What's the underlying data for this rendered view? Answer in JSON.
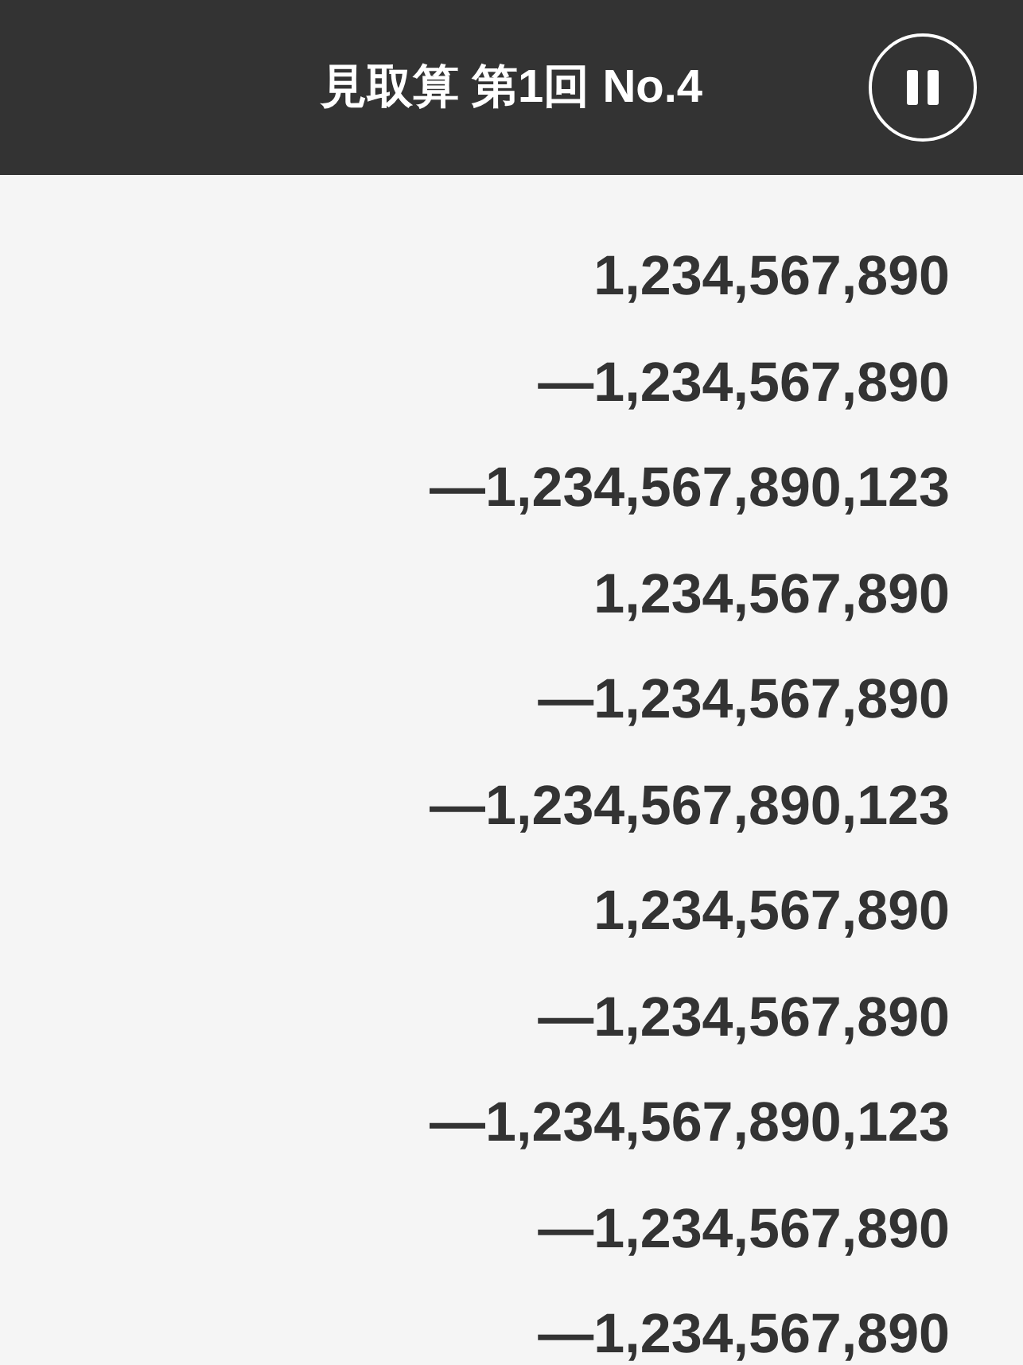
{
  "header": {
    "title": "見取算 第1回 No.4"
  },
  "numbers": [
    "1,234,567,890",
    "—1,234,567,890",
    "—1,234,567,890,123",
    "1,234,567,890",
    "—1,234,567,890",
    "—1,234,567,890,123",
    "1,234,567,890",
    "—1,234,567,890",
    "—1,234,567,890,123",
    "—1,234,567,890",
    "—1,234,567,890"
  ]
}
